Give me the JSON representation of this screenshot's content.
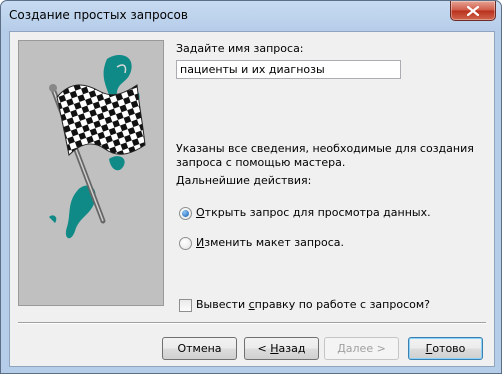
{
  "window": {
    "title": "Создание простых запросов"
  },
  "query_name": {
    "label": "Задайте имя запроса:",
    "value": "пациенты и их диагнозы"
  },
  "info": {
    "text": "Указаны все сведения, необходимые для создания запроса с помощью мастера.",
    "next_actions_label": "Дальнейшие действия:"
  },
  "options": [
    {
      "label_hotkey": "О",
      "label_rest": "ткрыть запрос для просмотра данных.",
      "selected": true
    },
    {
      "label_hotkey": "И",
      "label_rest": "зменить макет запроса.",
      "selected": false
    }
  ],
  "help_checkbox": {
    "label_prefix": "Вывести ",
    "label_hotkey": "с",
    "label_rest": "правку по работе с запросом?",
    "checked": false
  },
  "buttons": {
    "cancel": "Отмена",
    "back_prefix": "< ",
    "back_hotkey": "Н",
    "back_rest": "азад",
    "next": "Далее >",
    "finish_hotkey": "Г",
    "finish_rest": "отово"
  },
  "colors": {
    "accent_teal": "#0f8a87",
    "panel_gray": "#c0c0c0"
  },
  "icons": {
    "close": "close-icon",
    "wizard_image": "checkered-flag-icon"
  }
}
